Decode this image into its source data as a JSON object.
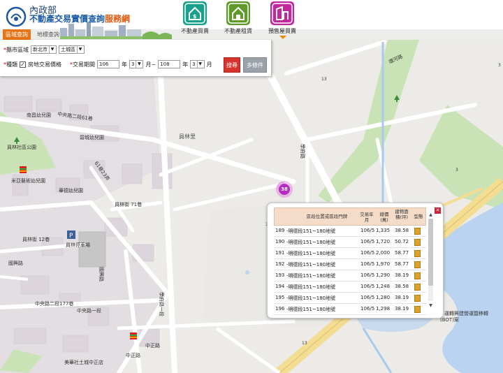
{
  "header": {
    "org": "內政部",
    "site_title_main": "不動產交易實價查詢",
    "site_title_accent": "服務網",
    "nav": [
      {
        "label": "不動產買賣",
        "icon": "house-dollar-icon",
        "color": "#1aa08c"
      },
      {
        "label": "不動產租賃",
        "icon": "house-rent-icon",
        "color": "#5f9a2a"
      },
      {
        "label": "預售屋買賣",
        "icon": "presale-building-icon",
        "color": "#c0289c"
      }
    ],
    "tabs": {
      "active": "區域查詢",
      "inactive": "地標查詢"
    }
  },
  "search": {
    "county_label": "縣市區域",
    "county_value": "新北市",
    "district_value": "土城區",
    "type_label": "種類",
    "land_checkbox_label": "房地交易價格",
    "land_checked": true,
    "period_label": "交易期間",
    "start_year": "106",
    "year_unit": "年",
    "start_month": "3",
    "month_unit": "月~",
    "end_year": "108",
    "end_month": "3",
    "end_month_unit": "月",
    "search_button": "搜尋",
    "more_button": "多條件"
  },
  "map": {
    "labels": {
      "l1": "中央路二段61巷",
      "l2": "南昌幼兒園",
      "l3": "碧城幼兒園",
      "l4": "員林社區公園",
      "l5": "61巷23弄",
      "l6": "米亞藝術幼兒園",
      "l7": "華德幼兒園",
      "l8": "員林里",
      "l9": "員林街 71巷",
      "l10": "員林街 12巷",
      "l11": "員林停車場",
      "l12": "中央路二段177巷",
      "l13": "學府路一段",
      "l14": "中正路",
      "l15": "美華社土城中正店",
      "l16": "環河路",
      "l17": "學府路",
      "l18": "國興路",
      "l19": "(BOT)案",
      "l20": "國興路",
      "l21": "運轉興建營運暨移轉",
      "l22": "中正路",
      "l23": "中央路一段"
    },
    "marker_count": "38",
    "shield_labels": [
      "3",
      "13",
      "3",
      "13",
      "3"
    ]
  },
  "popup": {
    "headers": {
      "address": "區段位置或區段門牌",
      "date": "交易年月",
      "price": "總價(萬)",
      "area": "建物面積(坪)",
      "type": "型態"
    },
    "rows": [
      {
        "id": "189",
        "address": "-明德段151~180地號",
        "date": "106/5",
        "price": "1,335",
        "area": "38.58"
      },
      {
        "id": "190",
        "address": "-明德段151~180地號",
        "date": "106/5",
        "price": "1,720",
        "area": "50.72"
      },
      {
        "id": "191",
        "address": "-明德段151~180地號",
        "date": "106/5",
        "price": "2,000",
        "area": "58.77"
      },
      {
        "id": "192",
        "address": "-明德段151~180地號",
        "date": "106/5",
        "price": "1,970",
        "area": "58.77"
      },
      {
        "id": "193",
        "address": "-明德段151~180地號",
        "date": "106/5",
        "price": "1,290",
        "area": "38.19"
      },
      {
        "id": "194",
        "address": "-明德段151~180地號",
        "date": "106/5",
        "price": "1,248",
        "area": "38.58"
      },
      {
        "id": "195",
        "address": "-明德段151~180地號",
        "date": "106/5",
        "price": "1,280",
        "area": "38.19"
      },
      {
        "id": "196",
        "address": "-明德段151~180地號",
        "date": "106/5",
        "price": "1,298",
        "area": "38.19"
      }
    ],
    "scroll_fraction": 0.92
  }
}
